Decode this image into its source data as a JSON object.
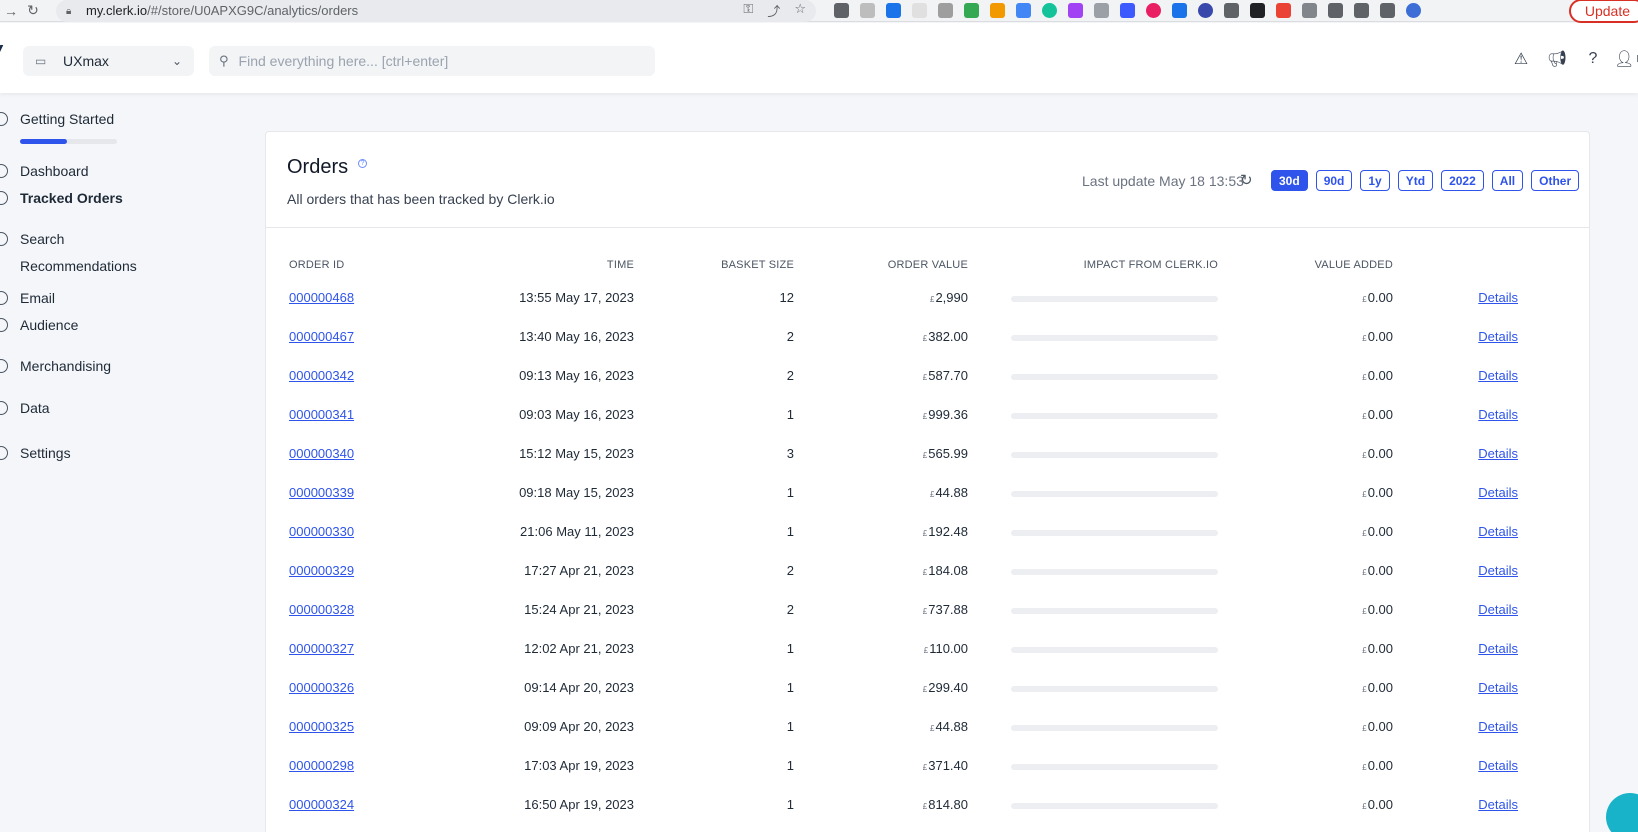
{
  "browser": {
    "url_host": "my.clerk.io",
    "url_path": "/#/store/U0APXG9C/analytics/orders",
    "update_label": "Update"
  },
  "header": {
    "store_name": "UXmax",
    "search_placeholder": "Find everything here... [ctrl+enter]",
    "profile_initial": "N"
  },
  "sidebar": {
    "getting_started": "Getting Started",
    "getting_started_progress": 0.48,
    "items": [
      {
        "label": "Dashboard"
      },
      {
        "label": "Tracked Orders"
      },
      {
        "label": "Search"
      },
      {
        "label": "Recommendations"
      },
      {
        "label": "Email"
      },
      {
        "label": "Audience"
      },
      {
        "label": "Merchandising"
      },
      {
        "label": "Data"
      },
      {
        "label": "Settings"
      }
    ]
  },
  "page": {
    "title": "Orders",
    "subtitle": "All orders that has been tracked by Clerk.io",
    "last_update": "Last update May 18 13:53",
    "ranges": [
      "30d",
      "90d",
      "1y",
      "Ytd",
      "2022",
      "All",
      "Other"
    ],
    "active_range": "30d"
  },
  "table": {
    "columns": [
      "ORDER ID",
      "TIME",
      "BASKET SIZE",
      "ORDER VALUE",
      "IMPACT FROM CLERK.IO",
      "VALUE ADDED"
    ],
    "currency": "£",
    "details_label": "Details",
    "rows": [
      {
        "id": "000000468",
        "time": "13:55 May 17, 2023",
        "basket": "12",
        "value": "2,990",
        "impact": 0,
        "added": "0.00"
      },
      {
        "id": "000000467",
        "time": "13:40 May 16, 2023",
        "basket": "2",
        "value": "382.00",
        "impact": 0,
        "added": "0.00"
      },
      {
        "id": "000000342",
        "time": "09:13 May 16, 2023",
        "basket": "2",
        "value": "587.70",
        "impact": 0,
        "added": "0.00"
      },
      {
        "id": "000000341",
        "time": "09:03 May 16, 2023",
        "basket": "1",
        "value": "999.36",
        "impact": 0,
        "added": "0.00"
      },
      {
        "id": "000000340",
        "time": "15:12 May 15, 2023",
        "basket": "3",
        "value": "565.99",
        "impact": 0,
        "added": "0.00"
      },
      {
        "id": "000000339",
        "time": "09:18 May 15, 2023",
        "basket": "1",
        "value": "44.88",
        "impact": 0,
        "added": "0.00"
      },
      {
        "id": "000000330",
        "time": "21:06 May 11, 2023",
        "basket": "1",
        "value": "192.48",
        "impact": 0,
        "added": "0.00"
      },
      {
        "id": "000000329",
        "time": "17:27 Apr 21, 2023",
        "basket": "2",
        "value": "184.08",
        "impact": 0,
        "added": "0.00"
      },
      {
        "id": "000000328",
        "time": "15:24 Apr 21, 2023",
        "basket": "2",
        "value": "737.88",
        "impact": 0,
        "added": "0.00"
      },
      {
        "id": "000000327",
        "time": "12:02 Apr 21, 2023",
        "basket": "1",
        "value": "110.00",
        "impact": 0,
        "added": "0.00"
      },
      {
        "id": "000000326",
        "time": "09:14 Apr 20, 2023",
        "basket": "1",
        "value": "299.40",
        "impact": 0,
        "added": "0.00"
      },
      {
        "id": "000000325",
        "time": "09:09 Apr 20, 2023",
        "basket": "1",
        "value": "44.88",
        "impact": 0,
        "added": "0.00"
      },
      {
        "id": "000000298",
        "time": "17:03 Apr 19, 2023",
        "basket": "1",
        "value": "371.40",
        "impact": 0,
        "added": "0.00"
      },
      {
        "id": "000000324",
        "time": "16:50 Apr 19, 2023",
        "basket": "1",
        "value": "814.80",
        "impact": 0,
        "added": "0.00"
      }
    ]
  },
  "colors": {
    "accent": "#2f54eb",
    "chat": "#19b3c9"
  }
}
